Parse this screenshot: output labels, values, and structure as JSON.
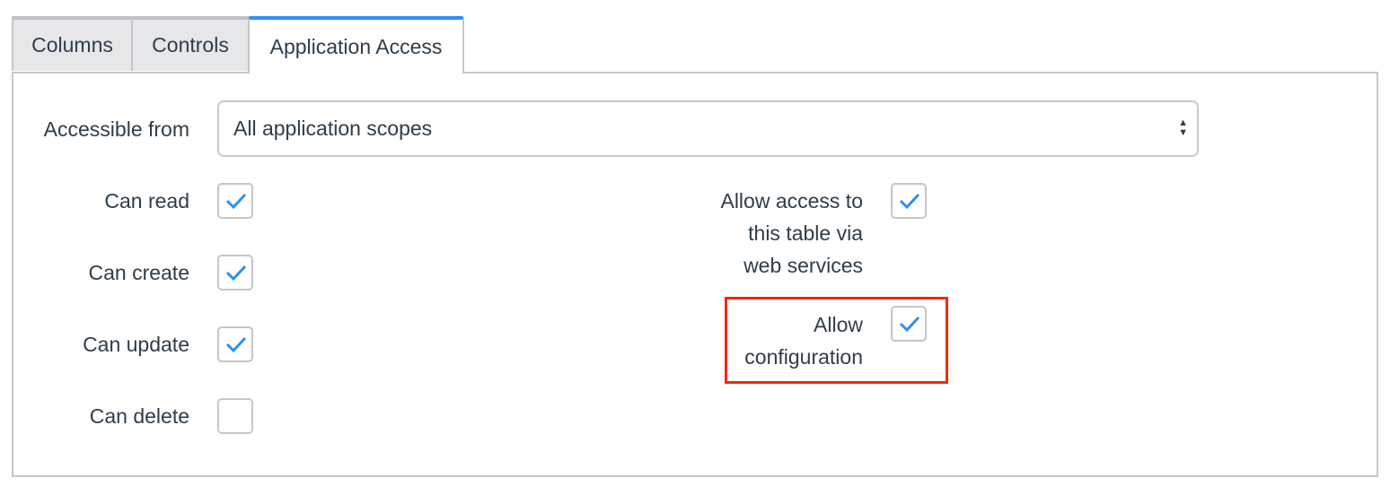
{
  "tabs": [
    {
      "label": "Columns",
      "active": false
    },
    {
      "label": "Controls",
      "active": false
    },
    {
      "label": "Application Access",
      "active": true
    }
  ],
  "accessible_from": {
    "label": "Accessible from",
    "value": "All application scopes"
  },
  "left_checks": [
    {
      "label": "Can read",
      "checked": true
    },
    {
      "label": "Can create",
      "checked": true
    },
    {
      "label": "Can update",
      "checked": true
    },
    {
      "label": "Can delete",
      "checked": false
    }
  ],
  "right_checks": [
    {
      "label_lines": [
        "Allow access to",
        "this table via",
        "web services"
      ],
      "checked": true
    },
    {
      "label_lines": [
        "Allow",
        "configuration"
      ],
      "checked": true,
      "highlighted": true
    }
  ],
  "colors": {
    "accent": "#2e8ff0",
    "highlight": "#f5290a"
  }
}
